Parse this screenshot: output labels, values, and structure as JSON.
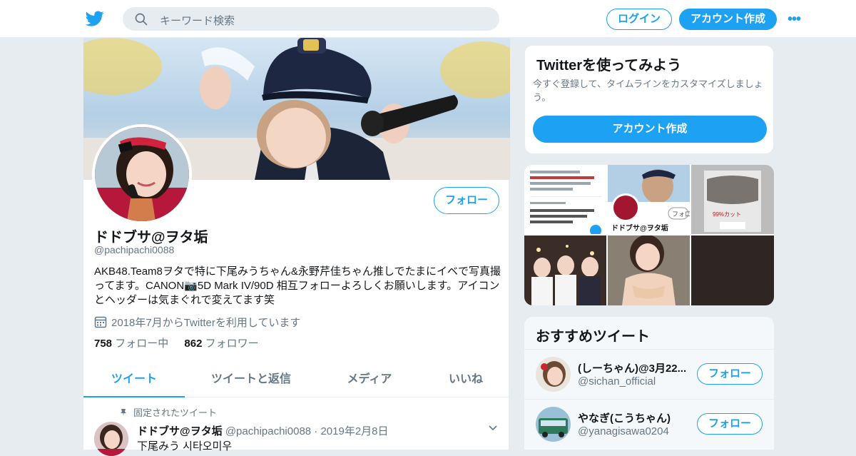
{
  "header": {
    "search_placeholder": "キーワード検索",
    "login_label": "ログイン",
    "signup_label": "アカウント作成",
    "more_label": "•••"
  },
  "profile": {
    "name": "ドドブサ@ヲタ垢",
    "handle": "@pachipachi0088",
    "follow_label": "フォロー",
    "bio": "AKB48.Team8ヲタで特に下尾みうちゃん&永野芹佳ちゃん推しでたまにイベで写真撮ってます。CANON📷5D Mark IV/90D 相互フォローよろしくお願いします。アイコンとヘッダーは気まぐれで変えてます笑",
    "joined": "2018年7月からTwitterを利用しています",
    "following_count": "758",
    "following_label": "フォロー中",
    "followers_count": "862",
    "followers_label": "フォロワー"
  },
  "tabs": [
    {
      "label": "ツイート",
      "active": true
    },
    {
      "label": "ツイートと返信",
      "active": false
    },
    {
      "label": "メディア",
      "active": false
    },
    {
      "label": "いいね",
      "active": false
    }
  ],
  "pinned_tweet": {
    "pinned_label": "固定されたツイート",
    "name": "ドドブサ@ヲタ垢",
    "meta": "@pachipachi0088 · 2019年2月8日",
    "text": "下尾みう 시타오미우"
  },
  "signup_card": {
    "title": "Twitterを使ってみよう",
    "description": "今すぐ登録して、タイムラインをカスタマイズしましょう。",
    "button_label": "アカウント作成"
  },
  "media_thumb_text": {
    "name": "ドドブサ@ヲタ垢",
    "follow_fragment": "フォロ",
    "mask_text": "99%カット"
  },
  "recommended": {
    "title": "おすすめツイート",
    "items": [
      {
        "name": "(しーちゃん)@3月22...",
        "handle": "@sichan_official",
        "follow_label": "フォロー"
      },
      {
        "name": "やなぎ(こうちゃん)",
        "handle": "@yanagisawa0204",
        "follow_label": "フォロー"
      }
    ]
  },
  "colors": {
    "accent": "#1da1f2",
    "text": "#14171a",
    "muted": "#657786",
    "border": "#e6ecf0"
  }
}
